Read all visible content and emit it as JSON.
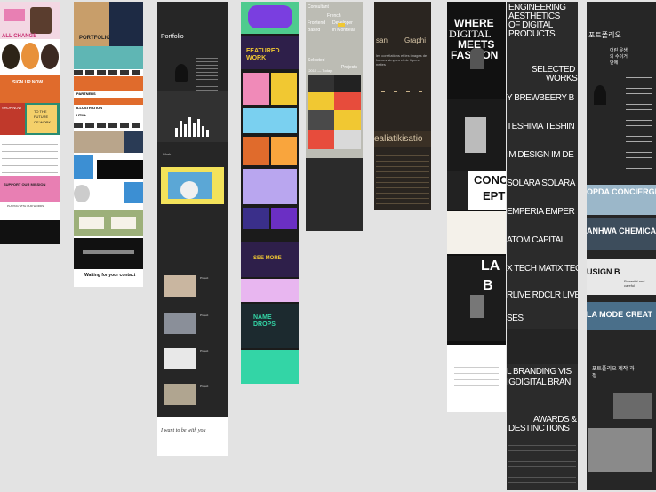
{
  "colors": {
    "canvas": "#e3e3e3",
    "pink": "#e87fb3",
    "dark": "#252525",
    "teal": "#5fb6b4",
    "orange": "#e06b2c",
    "yellow": "#f1c832",
    "green_mint": "#33d5a6",
    "purple": "#2e1f4a"
  },
  "col1": {
    "title_1": "ALL CHANGE",
    "sign_up": "SIGN UP NOW",
    "shop": "SHOP NOW",
    "badge_line_1": "TO THE",
    "badge_line_2": "FUTURE",
    "badge_line_3": "OF WORK",
    "support": "SUPPORT OUR MISSION",
    "footer": "PLAYING WITH OUR WORDS"
  },
  "col2": {
    "header": "PORTFOLIO",
    "row_1": "PARTNERS",
    "row_2": "ILLUSTRATION",
    "row_3": "HTML",
    "footer_title": "Waiting for your contact"
  },
  "col3": {
    "header": "Portfolio",
    "section": "Work",
    "cards": [
      "Project",
      "Project",
      "Project",
      "Project"
    ],
    "signoff": "I want to be with you"
  },
  "col4": {
    "featured": "FEATURED WORK",
    "see_more": "SEE MORE",
    "name_drops": "NAME DROPS"
  },
  "col5": {
    "consultant": "Consultant",
    "french": "French",
    "frontend": "Frontend",
    "developer": "Developer",
    "based": "Based",
    "montreal": "in Montreal",
    "selected": "Selected",
    "projects": "Projects",
    "years": "(2015 — Today)"
  },
  "col6": {
    "word_1": "san",
    "word_2": "Graphi",
    "paragraph": "les corrélations et les images de formes simples et de lignes nettes",
    "banner": "ealiatikisatio"
  },
  "col7": {
    "h1": "WHERE",
    "h2": "DIGITAL",
    "h3": "MEETS",
    "h4": "FASHION",
    "concept_1": "CONC",
    "concept_2": "EPT",
    "lab": "LA",
    "lab_b": "B"
  },
  "col8": {
    "h1": "ENGINEERING",
    "h2": "AESTHETICS",
    "h3": "OF DIGITAL",
    "h4": "PRODUCTS",
    "selected_1": "SELECTED",
    "selected_2": "WORKS",
    "marquee": [
      "Y BREWBEERY B",
      "TESHIMA TESHIN",
      "IM DESIGN IM DE",
      "SOLARA SOLARA",
      "EMPERIA EMPER",
      "ATOM CAPITAL",
      "X TECH MATIX TEC",
      "RLIVE RDCLR LIVE",
      "SES"
    ],
    "branding_1": "L BRANDING VIS",
    "branding_2": "IGDIGITAL BRAN",
    "awards_1": "AWARDS &",
    "awards_2": "DESTINCTIONS"
  },
  "col9": {
    "header": "포트폴리오",
    "sub": "어린 유생의 수이거 안에",
    "banners": [
      "OPDA CONCIERGE D",
      "ANHWA CHEMICAL",
      "USIGN B",
      "LA MODE CREAT"
    ],
    "powerful": "Powerful and careful",
    "footer": "포트폴리오 제작 과정"
  }
}
